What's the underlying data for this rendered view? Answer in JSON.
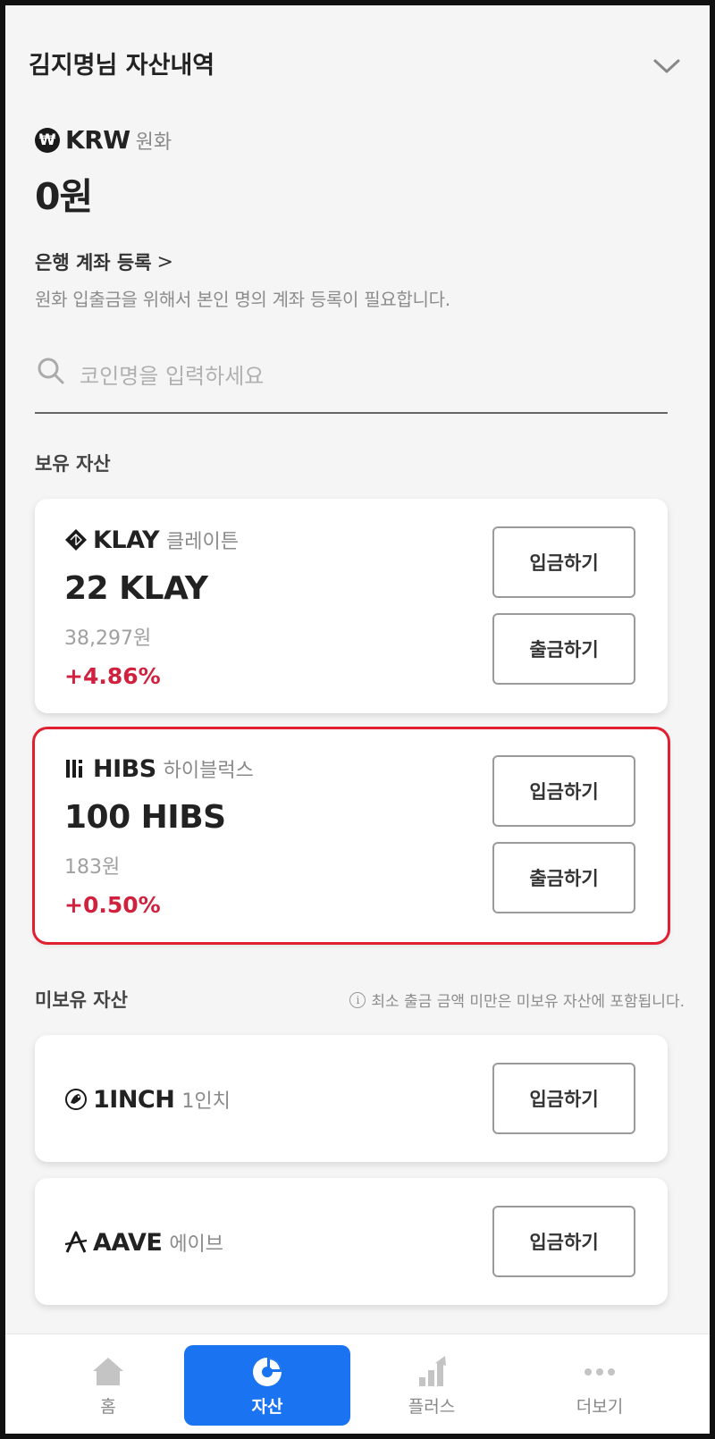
{
  "header": {
    "title": "김지명님 자산내역"
  },
  "krw": {
    "symbol": "₩",
    "code": "KRW",
    "name": "원화",
    "amount": "0원"
  },
  "bank": {
    "link_label": "은행 계좌 등록",
    "chevron": ">",
    "description": "원화 입출금을 위해서 본인 명의 계좌 등록이 필요합니다."
  },
  "search": {
    "placeholder": "코인명을 입력하세요",
    "value": "",
    "icon": "search-icon"
  },
  "owned": {
    "title": "보유 자산",
    "items": [
      {
        "code": "KLAY",
        "name": "클레이튼",
        "amount": "22 KLAY",
        "krw": "38,297원",
        "change": "+4.86%",
        "deposit": "입금하기",
        "withdraw": "출금하기"
      },
      {
        "code": "HIBS",
        "name": "하이블럭스",
        "amount": "100 HIBS",
        "krw": "183원",
        "change": "+0.50%",
        "deposit": "입금하기",
        "withdraw": "출금하기"
      }
    ]
  },
  "unowned": {
    "title": "미보유 자산",
    "notice_icon": "i",
    "notice": "최소 출금 금액 미만은 미보유 자산에 포함됩니다.",
    "items": [
      {
        "code": "1INCH",
        "name": "1인치",
        "deposit": "입금하기"
      },
      {
        "code": "AAVE",
        "name": "에이브",
        "deposit": "입금하기"
      }
    ]
  },
  "tabs": [
    {
      "label": "홈",
      "icon": "home-icon",
      "active": false
    },
    {
      "label": "자산",
      "icon": "pie-chart-icon",
      "active": true
    },
    {
      "label": "플러스",
      "icon": "bar-chart-icon",
      "active": false
    },
    {
      "label": "더보기",
      "icon": "more-dots-icon",
      "active": false
    }
  ],
  "colors": {
    "accent": "#1a73f0",
    "positive": "#d0223f",
    "highlight_border": "#e02030",
    "background": "#f5f5f5"
  }
}
